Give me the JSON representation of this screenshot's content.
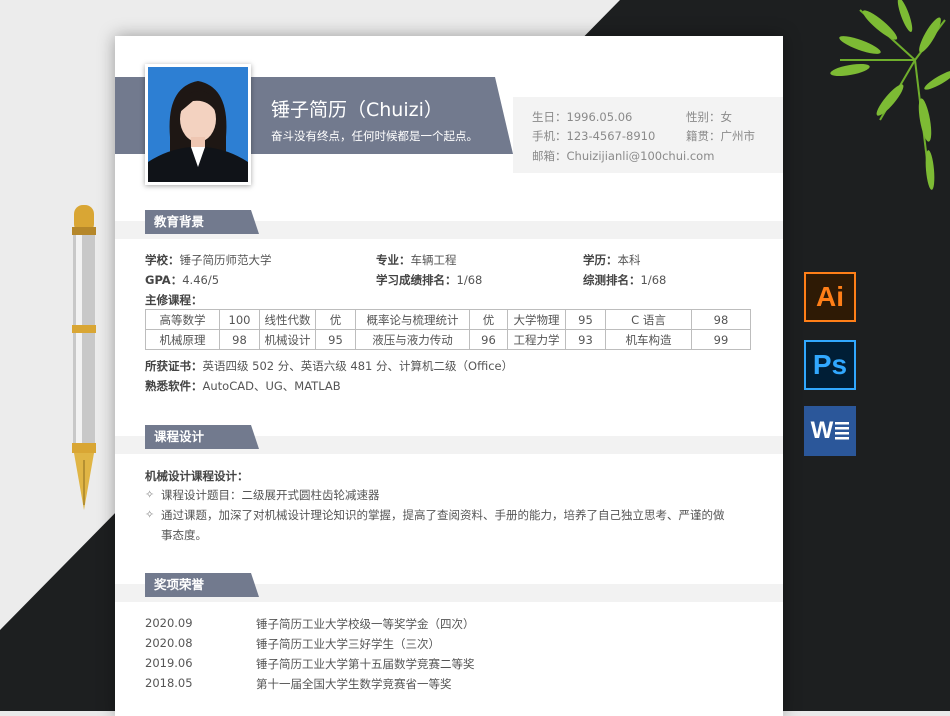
{
  "header": {
    "name": "锤子简历（Chuizi）",
    "motto": "奋斗没有终点，任何时候都是一个起点。",
    "birth": "生日：1996.05.06",
    "gender": "性别：女",
    "phone": "手机：123-4567-8910",
    "origin": "籍贯：广州市",
    "email": "邮箱：Chuizijianli@100chui.com"
  },
  "education": {
    "title": "教育背景",
    "school_label": "学校：",
    "school": "锤子简历师范大学",
    "major_label": "专业：",
    "major": "车辆工程",
    "degree_label": "学历：",
    "degree": "本科",
    "gpa_label": "GPA：",
    "gpa": "4.46/5",
    "rank_label": "学习成绩排名：",
    "rank": "1/68",
    "overall_label": "综测排名：",
    "overall": "1/68",
    "courses_label": "主修课程：",
    "courses": [
      [
        "高等数学",
        "100",
        "线性代数",
        "优",
        "概率论与梳理统计",
        "优",
        "大学物理",
        "95",
        "C 语言",
        "98"
      ],
      [
        "机械原理",
        "98",
        "机械设计",
        "95",
        "液压与液力传动",
        "96",
        "工程力学",
        "93",
        "机车构造",
        "99"
      ]
    ],
    "cert_label": "所获证书：",
    "cert": "英语四级 502 分、英语六级 481 分、计算机二级（Office）",
    "software_label": "熟悉软件：",
    "software": "AutoCAD、UG、MATLAB"
  },
  "design": {
    "title": "课程设计",
    "subtitle": "机械设计课程设计：",
    "bullet": "✧",
    "item1": "课程设计题目：二级展开式圆柱齿轮减速器",
    "item2a": "通过课题，加深了对机械设计理论知识的掌握，提高了查阅资料、手册的能力，培养了自己独立思考、严谨的做",
    "item2b": "事态度。"
  },
  "awards": {
    "title": "奖项荣誉",
    "items": [
      {
        "date": "2020.09",
        "text": "锤子简历工业大学校级一等奖学金（四次）"
      },
      {
        "date": "2020.08",
        "text": "锤子简历工业大学三好学生（三次）"
      },
      {
        "date": "2019.06",
        "text": "锤子简历工业大学第十五届数学竞赛二等奖"
      },
      {
        "date": "2018.05",
        "text": "第十一届全国大学生数学竞赛省一等奖"
      }
    ]
  },
  "apps": {
    "ai": "Ai",
    "ps": "Ps",
    "word": "W"
  },
  "colors": {
    "accent": "#727a8e",
    "dark_bg": "#1d1f20",
    "ai_orange": "#ff7f18",
    "ps_blue": "#31a8ff",
    "word_blue": "#2b579a"
  }
}
